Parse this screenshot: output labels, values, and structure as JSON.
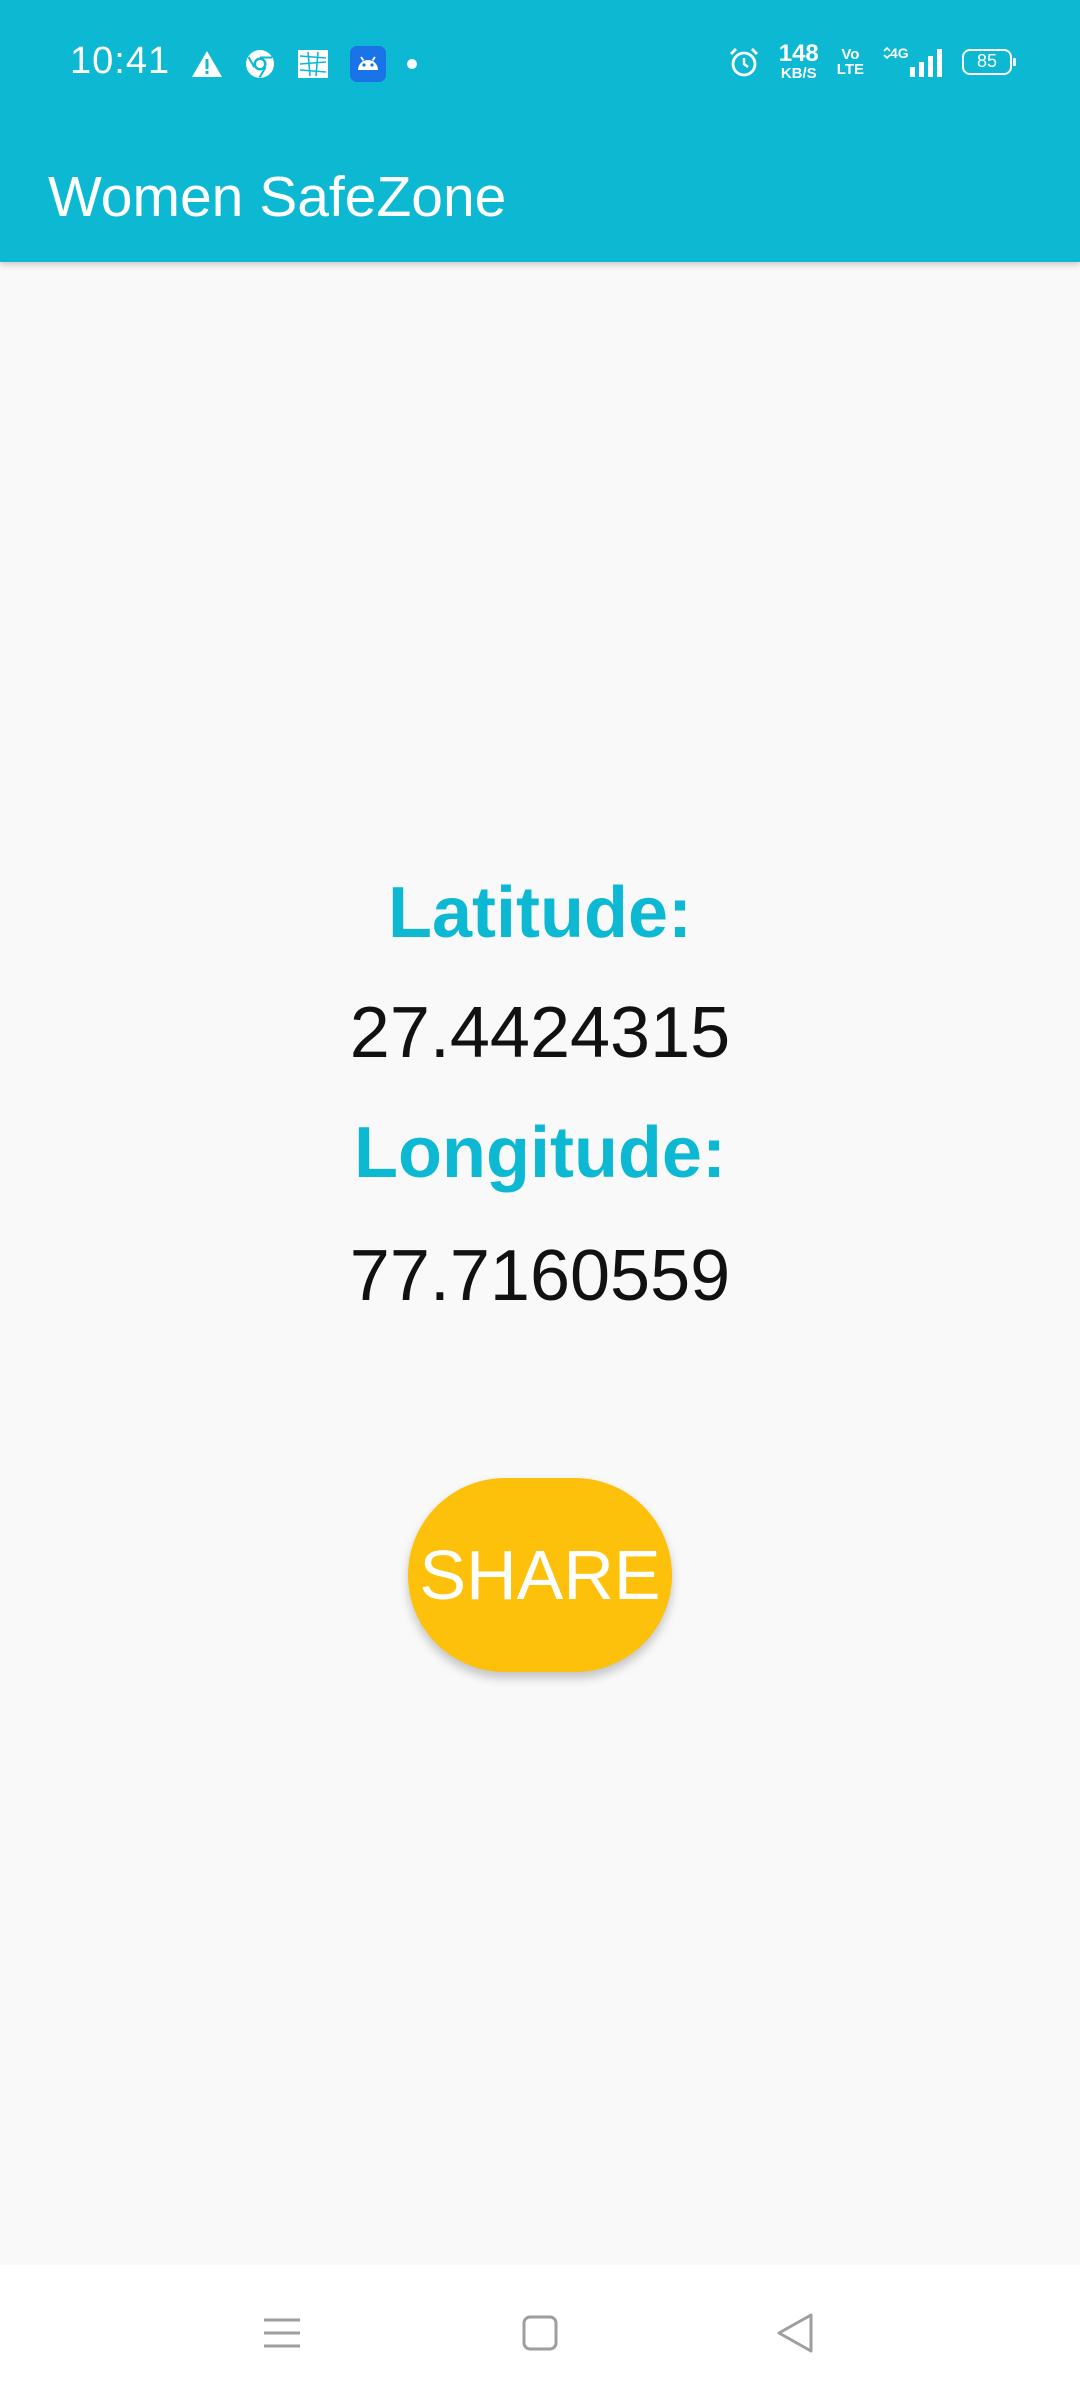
{
  "status_bar": {
    "time": "10:41",
    "left_icons": [
      "warning-icon",
      "chrome-icon",
      "gallery-icon",
      "android-icon",
      "dot-icon"
    ],
    "network_speed": "148",
    "network_speed_unit": "KB/S",
    "volte_top": "Vo",
    "volte_bottom": "LTE",
    "network_type": "4G",
    "battery_level": "85",
    "colors": {
      "background": "#0db9d2",
      "foreground": "#ffffff"
    }
  },
  "app_bar": {
    "title": "Women SafeZone"
  },
  "location": {
    "latitude_label": "Latitude:",
    "latitude_value": "27.4424315",
    "longitude_label": "Longitude:",
    "longitude_value": "77.7160559"
  },
  "actions": {
    "share_label": "SHARE"
  },
  "nav_bar": {
    "items": [
      "menu-icon",
      "home-icon",
      "back-icon"
    ]
  },
  "colors": {
    "accent": "#0db9d2",
    "share_button": "#fdc10b",
    "background": "#f9f9f9",
    "value_text": "#111111"
  }
}
